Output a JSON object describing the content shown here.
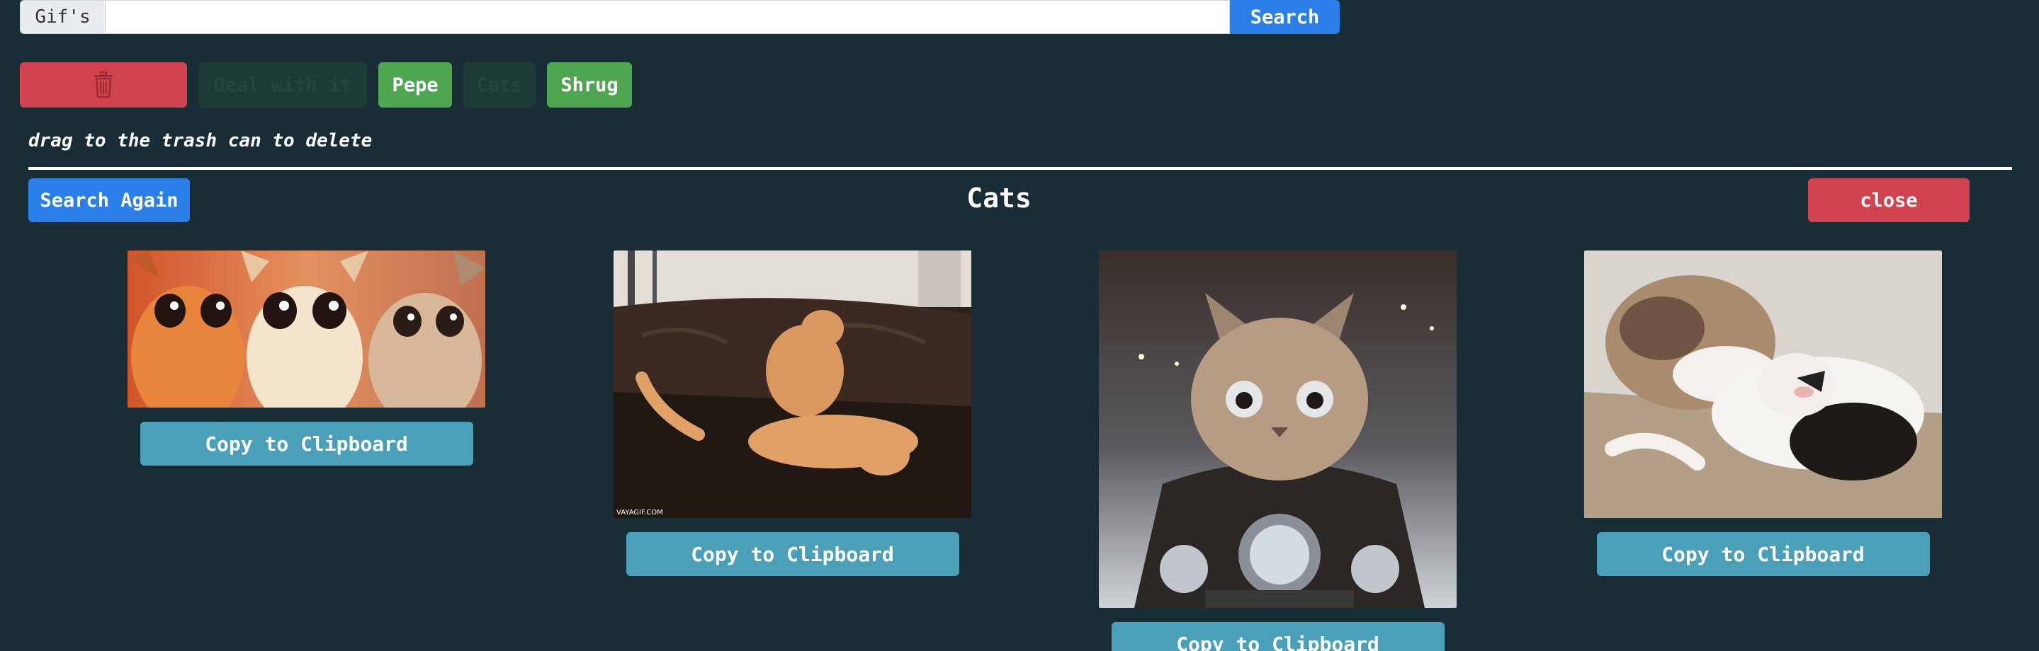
{
  "search": {
    "prefix": "Gif's",
    "value": "",
    "placeholder": "",
    "button_label": "Search"
  },
  "tags": {
    "trash_icon": "trash-icon",
    "items": [
      {
        "label": "Deal with it",
        "state": "faded"
      },
      {
        "label": "Pepe",
        "state": "active"
      },
      {
        "label": "Cats",
        "state": "faded"
      },
      {
        "label": "Shrug",
        "state": "active"
      }
    ]
  },
  "hint": "drag to the trash can to delete",
  "results": {
    "search_again_label": "Search Again",
    "title": "Cats",
    "close_label": "close",
    "gifs": [
      {
        "caption": "",
        "copy_label": "Copy to Clipboard"
      },
      {
        "caption": "VAYAGIF.COM",
        "copy_label": "Copy to Clipboard"
      },
      {
        "caption": "",
        "copy_label": "Copy to Clipboard"
      },
      {
        "caption": "",
        "copy_label": "Copy to Clipboard"
      }
    ]
  },
  "colors": {
    "background": "#182d35",
    "primary": "#2a7fe8",
    "danger": "#d0434f",
    "success": "#4ea650",
    "info": "#4aa0b8"
  }
}
